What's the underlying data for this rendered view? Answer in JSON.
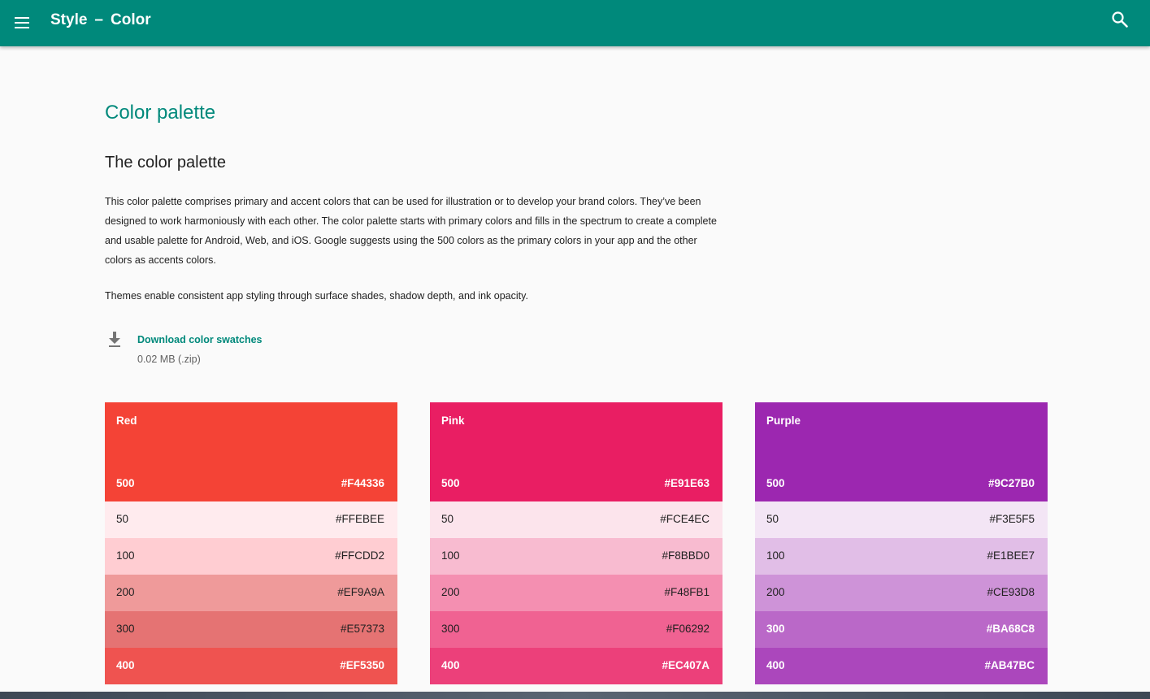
{
  "appbar": {
    "title_section": "Style",
    "title_separator": "–",
    "title_page": "Color",
    "color": "#00897b",
    "menu_icon": "hamburger-menu-icon",
    "search_icon": "search-icon"
  },
  "main": {
    "page_title": "Color palette",
    "section_title": "The color palette",
    "intro_paragraph": "This color palette comprises primary and accent colors that can be used for illustration or to develop your brand colors. They’ve been designed to work harmoniously with each other. The color palette starts with primary colors and fills in the spectrum to create a complete and usable palette for Android, Web, and iOS. Google suggests using the 500 colors as the primary colors in your app and the other colors as accents colors.",
    "themes_paragraph": "Themes enable consistent app styling through surface shades, shadow depth, and ink opacity.",
    "download": {
      "icon": "download-icon",
      "link_label": "Download color swatches",
      "size": "0.02 MB (.zip)"
    }
  },
  "palettes": [
    {
      "name": "Red",
      "primary": {
        "shade": "500",
        "hex": "#F44336"
      },
      "shades": [
        {
          "shade": "50",
          "hex": "#FFEBEE",
          "text": "dark"
        },
        {
          "shade": "100",
          "hex": "#FFCDD2",
          "text": "dark"
        },
        {
          "shade": "200",
          "hex": "#EF9A9A",
          "text": "dark"
        },
        {
          "shade": "300",
          "hex": "#E57373",
          "text": "dark"
        },
        {
          "shade": "400",
          "hex": "#EF5350",
          "text": "light"
        }
      ]
    },
    {
      "name": "Pink",
      "primary": {
        "shade": "500",
        "hex": "#E91E63"
      },
      "shades": [
        {
          "shade": "50",
          "hex": "#FCE4EC",
          "text": "dark"
        },
        {
          "shade": "100",
          "hex": "#F8BBD0",
          "text": "dark"
        },
        {
          "shade": "200",
          "hex": "#F48FB1",
          "text": "dark"
        },
        {
          "shade": "300",
          "hex": "#F06292",
          "text": "dark"
        },
        {
          "shade": "400",
          "hex": "#EC407A",
          "text": "light"
        }
      ]
    },
    {
      "name": "Purple",
      "primary": {
        "shade": "500",
        "hex": "#9C27B0"
      },
      "shades": [
        {
          "shade": "50",
          "hex": "#F3E5F5",
          "text": "dark"
        },
        {
          "shade": "100",
          "hex": "#E1BEE7",
          "text": "dark"
        },
        {
          "shade": "200",
          "hex": "#CE93D8",
          "text": "dark"
        },
        {
          "shade": "300",
          "hex": "#BA68C8",
          "text": "light"
        },
        {
          "shade": "400",
          "hex": "#AB47BC",
          "text": "light"
        }
      ]
    }
  ]
}
